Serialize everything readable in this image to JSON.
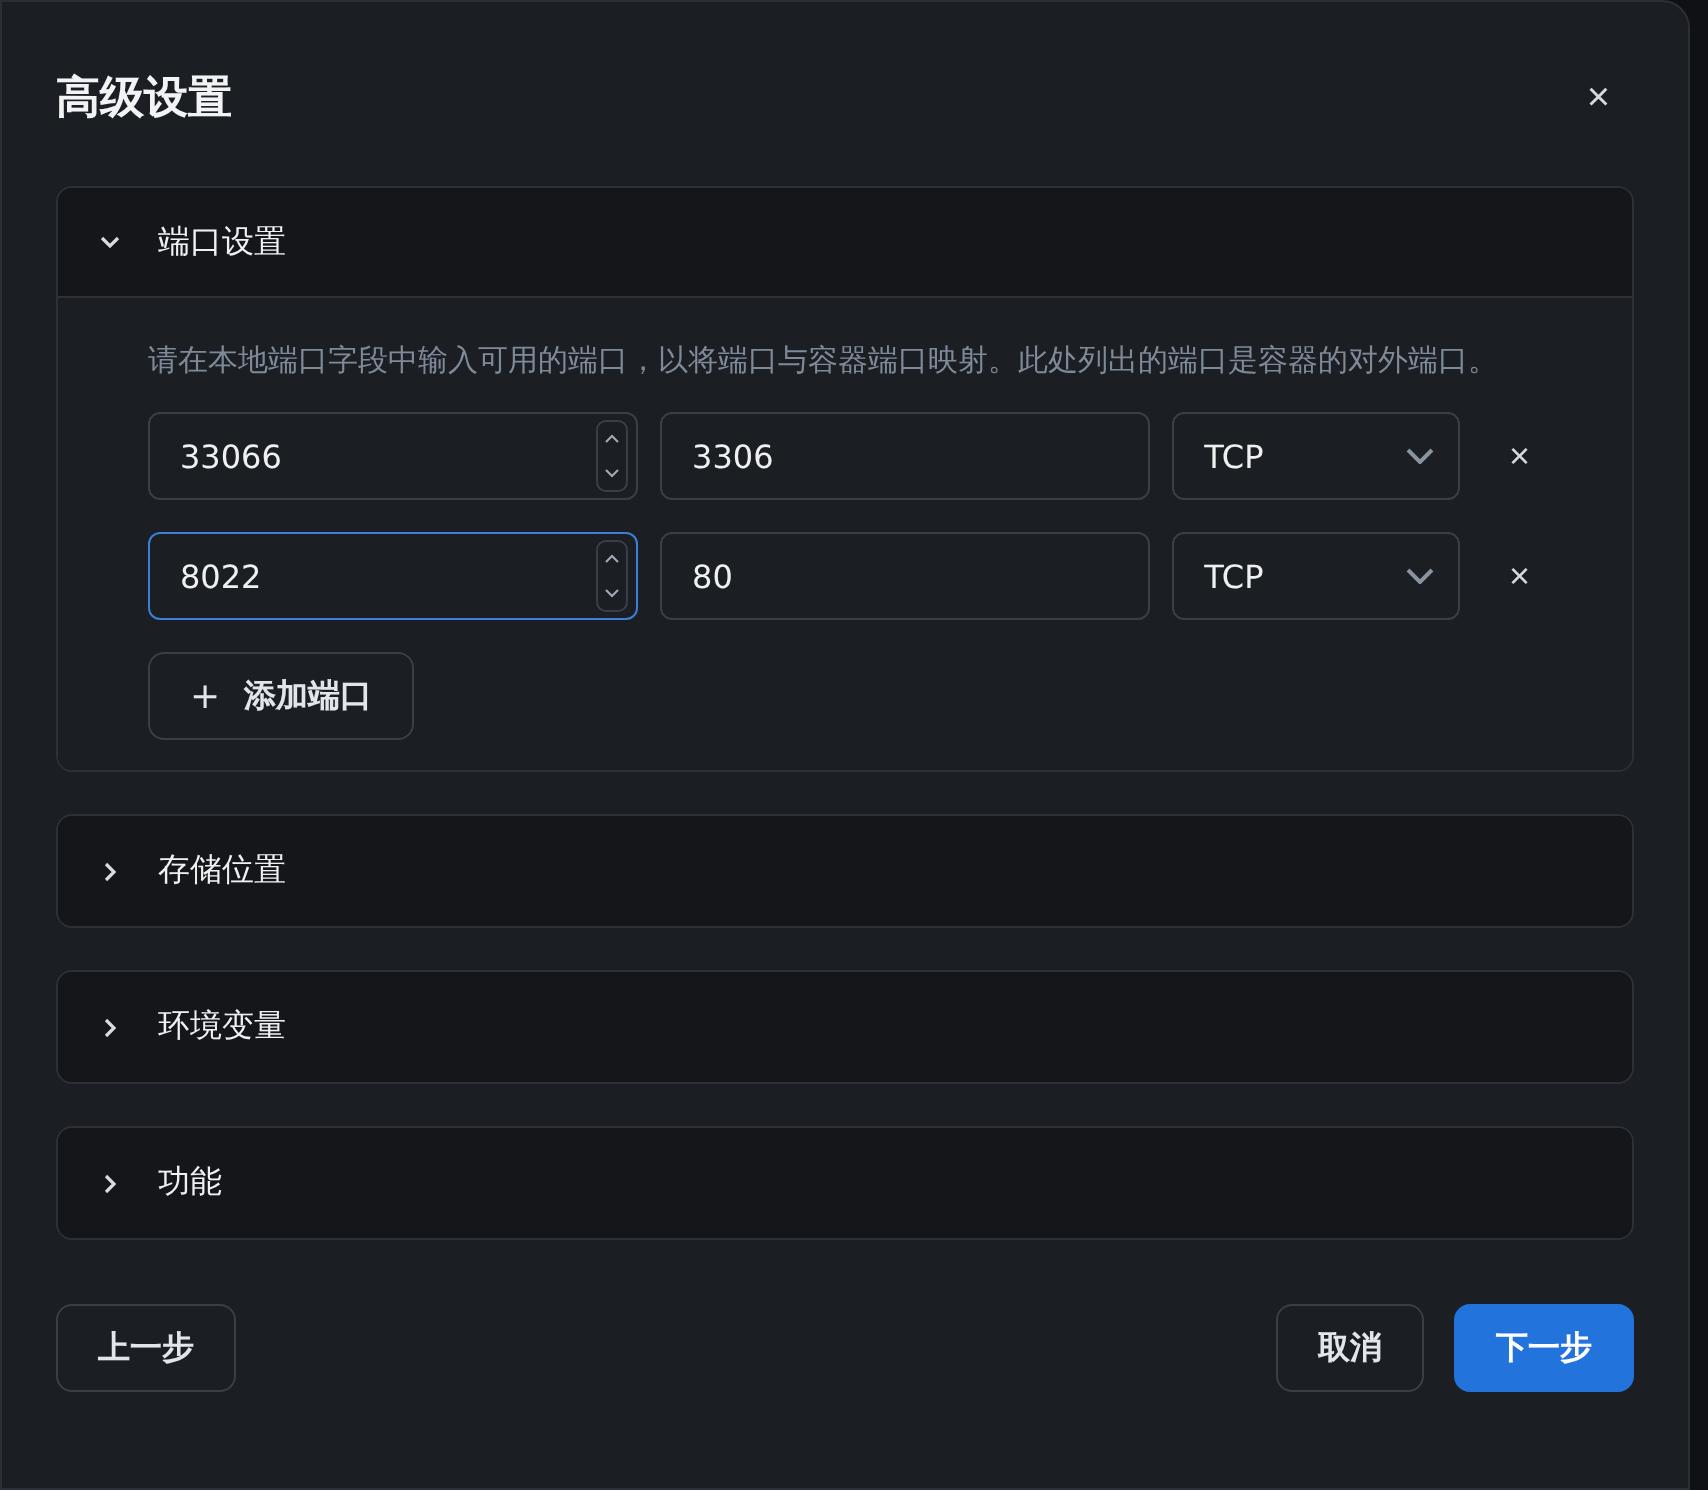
{
  "dialog": {
    "title": "高级设置",
    "close": "×"
  },
  "sections": [
    {
      "title": "端口设置",
      "expanded": true,
      "description": "请在本地端口字段中输入可用的端口，以将端口与容器端口映射。此处列出的端口是容器的对外端口。",
      "ports": [
        {
          "host": "33066",
          "container": "3306",
          "protocol": "TCP",
          "focused": false,
          "remove": "×"
        },
        {
          "host": "8022",
          "container": "80",
          "protocol": "TCP",
          "focused": true,
          "remove": "×"
        }
      ],
      "add_button": {
        "icon": "+",
        "label": "添加端口"
      }
    },
    {
      "title": "存储位置",
      "expanded": false
    },
    {
      "title": "环境变量",
      "expanded": false
    },
    {
      "title": "功能",
      "expanded": false
    }
  ],
  "footer": {
    "left": [
      {
        "label": "上一步",
        "kind": "secondary"
      }
    ],
    "right": [
      {
        "label": "取消",
        "kind": "secondary"
      },
      {
        "label": "下一步",
        "kind": "primary"
      }
    ]
  }
}
